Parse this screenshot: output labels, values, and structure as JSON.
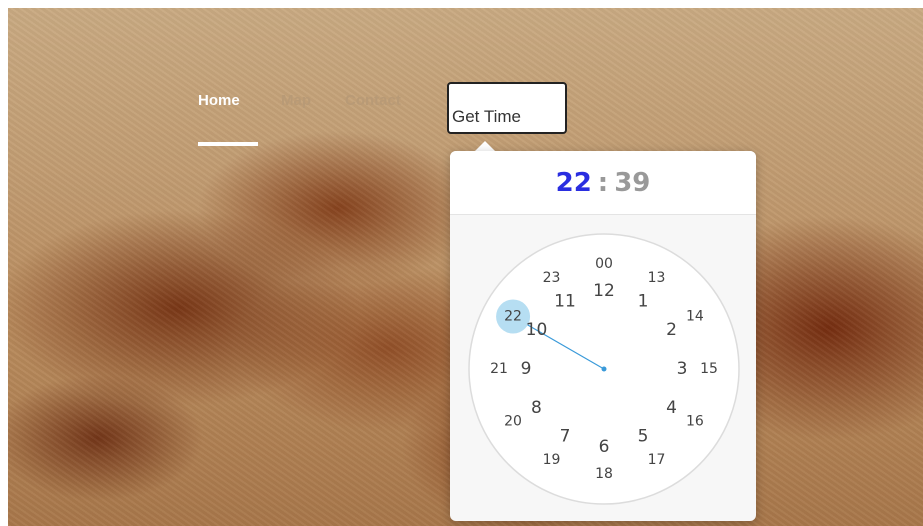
{
  "nav": {
    "home": "Home",
    "map": "Map",
    "contact": "Contact"
  },
  "input": {
    "value": "Get Time"
  },
  "clockpicker": {
    "hour": "22",
    "separator": ":",
    "minute": "39",
    "selected_hour": "22",
    "accent_color": "#2a2ee0",
    "highlight_color": "#b6def2",
    "hand_color": "#3a9ad9",
    "inner_hours": [
      "12",
      "1",
      "2",
      "3",
      "4",
      "5",
      "6",
      "7",
      "8",
      "9",
      "10",
      "11"
    ],
    "outer_hours": [
      "00",
      "13",
      "14",
      "15",
      "16",
      "17",
      "18",
      "19",
      "20",
      "21",
      "22",
      "23"
    ]
  }
}
